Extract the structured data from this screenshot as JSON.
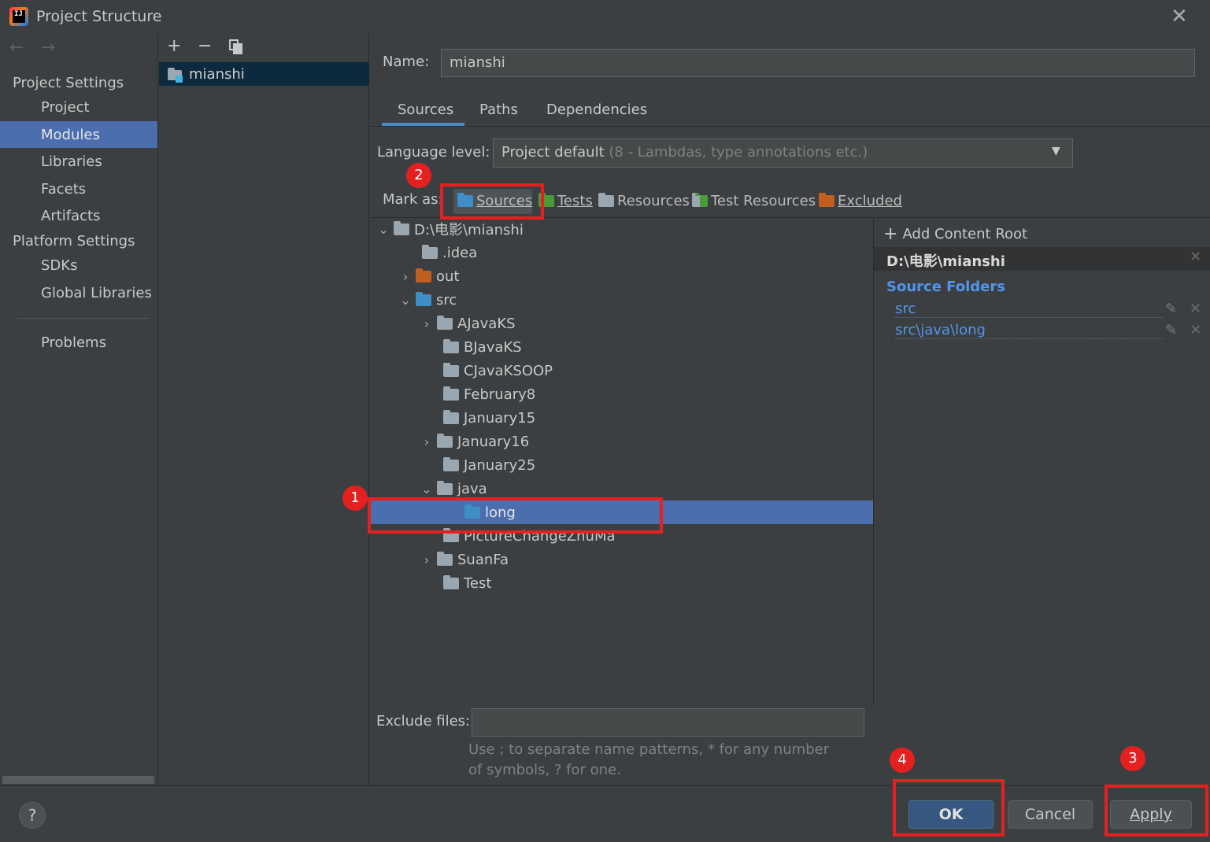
{
  "window": {
    "title": "Project Structure"
  },
  "nav": {
    "project_settings": "Project Settings",
    "project_items": [
      "Project",
      "Modules",
      "Libraries",
      "Facets",
      "Artifacts"
    ],
    "platform_settings": "Platform Settings",
    "platform_items": [
      "SDKs",
      "Global Libraries"
    ],
    "problems": "Problems",
    "selected": "Modules"
  },
  "modules": {
    "items": [
      "mianshi"
    ]
  },
  "name_field": {
    "label": "Name:",
    "value": "mianshi"
  },
  "tabs": [
    "Sources",
    "Paths",
    "Dependencies"
  ],
  "active_tab": "Sources",
  "language_level": {
    "label": "Language level:",
    "value": "Project default",
    "hint": "(8 - Lambdas, type annotations etc.)"
  },
  "mark_as": {
    "label": "Mark as:",
    "options": [
      "Sources",
      "Tests",
      "Resources",
      "Test Resources",
      "Excluded"
    ]
  },
  "tree": {
    "root": "D:\\电影\\mianshi",
    "items": [
      ".idea",
      "out",
      "src",
      "AJavaKS",
      "BJavaKS",
      "CJavaKSOOP",
      "February8",
      "January15",
      "January16",
      "January25",
      "java",
      "long",
      "PictureChangeZhuMa",
      "SuanFa",
      "Test"
    ],
    "selected": "long"
  },
  "content_root": {
    "add_label": "Add Content Root",
    "path": "D:\\电影\\mianshi",
    "source_folders_title": "Source Folders",
    "source_folders": [
      "src",
      "src\\java\\long"
    ]
  },
  "exclude_files": {
    "label": "Exclude files:",
    "value": "",
    "help": "Use ; to separate name patterns, * for any number of symbols, ? for one."
  },
  "buttons": {
    "help": "?",
    "ok": "OK",
    "cancel": "Cancel",
    "apply": "Apply"
  },
  "annotations": [
    "1",
    "2",
    "3",
    "4"
  ],
  "colors": {
    "accent": "#4b6eaf",
    "annotation_red": "#e52020",
    "source_folder_blue": "#3d8fc5",
    "excluded_orange": "#c15f21"
  }
}
